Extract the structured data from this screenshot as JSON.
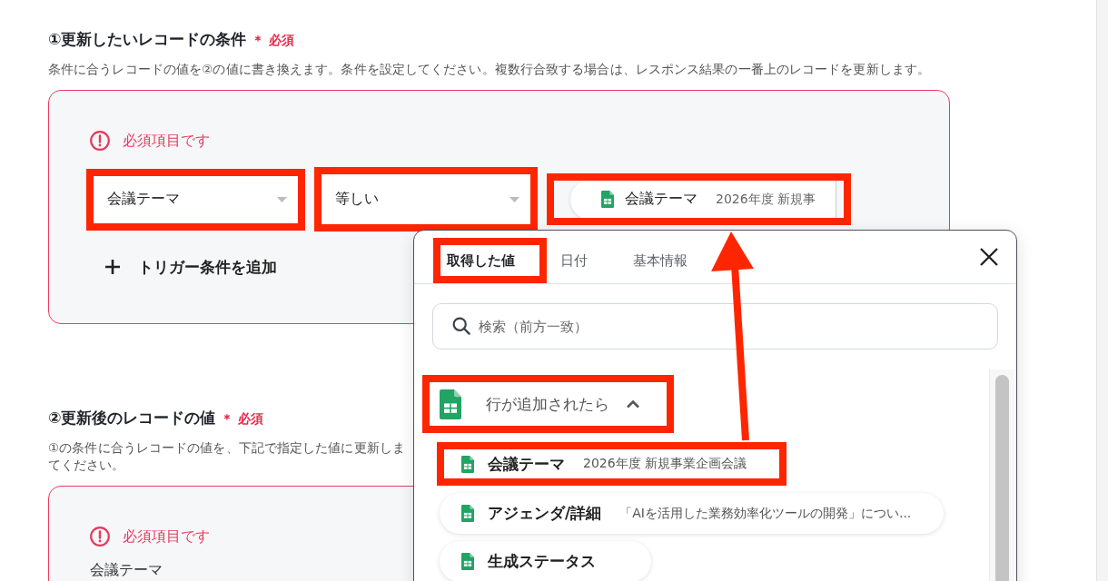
{
  "sections": [
    {
      "heading": "①更新したいレコードの条件",
      "required_label": "＊ 必須",
      "description": [
        "条件に合うレコードの値を②の値に書き換えます。条件を設定してください。複数行合致する場合は、レスポンス結果の一番上のレコードを更新します。"
      ],
      "card": {
        "kind": "conditions",
        "invalid": true,
        "error": "必須項目です",
        "conditions": [
          {
            "field": {
              "value": "会議テーマ",
              "highlighted": true
            },
            "operator": {
              "value": "等しい",
              "highlighted": true
            },
            "value": {
              "name": "会議テーマ",
              "text": "2026年度 新規事",
              "highlighted": true
            }
          }
        ],
        "add_button": "トリガー条件を追加"
      }
    },
    {
      "heading": "②更新後のレコードの値",
      "required_label": "＊ 必須",
      "description": [
        "①の条件に合うレコードの値を、下記で指定した値に更新しま",
        "てください。"
      ],
      "card": {
        "kind": "values",
        "invalid": true,
        "error": "必須項目です",
        "field_label": "会議テーマ"
      }
    }
  ],
  "popup": {
    "tabs": [
      {
        "label": "取得した値",
        "selected": true,
        "highlighted": true
      },
      {
        "label": "日付",
        "selected": false,
        "highlighted": false
      },
      {
        "label": "基本情報",
        "selected": false,
        "highlighted": false
      }
    ],
    "search": {
      "placeholder": "検索（前方一致）"
    },
    "group": {
      "title": "行が追加されたら",
      "expanded": true,
      "highlighted": true,
      "items": [
        {
          "name": "会議テーマ",
          "value": "2026年度 新規事業企画会議",
          "highlighted": true
        },
        {
          "name": "アジェンダ/詳細",
          "value": "「AIを活用した業務効率化ツールの開発」につい...",
          "highlighted": false
        },
        {
          "name": "生成ステータス",
          "highlighted": false
        }
      ]
    }
  },
  "arrow": {
    "shown": true
  }
}
